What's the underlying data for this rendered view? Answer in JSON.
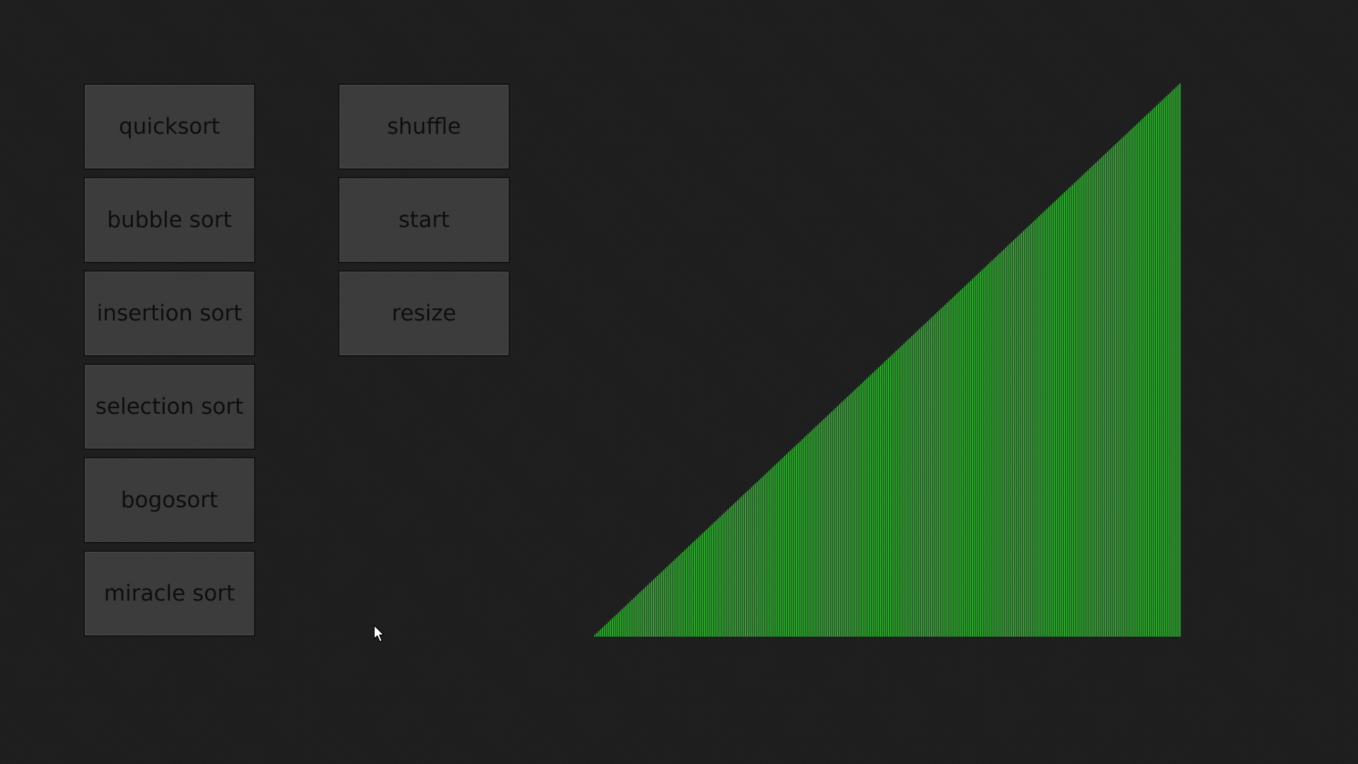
{
  "sort_buttons": [
    {
      "label": "quicksort"
    },
    {
      "label": "bubble sort"
    },
    {
      "label": "insertion sort"
    },
    {
      "label": "selection sort"
    },
    {
      "label": "bogosort"
    },
    {
      "label": "miracle sort"
    }
  ],
  "control_buttons": [
    {
      "label": "shuffle"
    },
    {
      "label": "start"
    },
    {
      "label": "resize"
    }
  ],
  "visualizer": {
    "bar_count": 300,
    "bar_color": "#2fa52f",
    "gap_color": "#0f3a0f",
    "state": "sorted-ascending"
  },
  "colors": {
    "background": "#1e1e1f",
    "button_face": "#3a3a3a",
    "button_text": "#0e0e0e"
  },
  "icons": {
    "pointer": "mouse-pointer-icon"
  }
}
